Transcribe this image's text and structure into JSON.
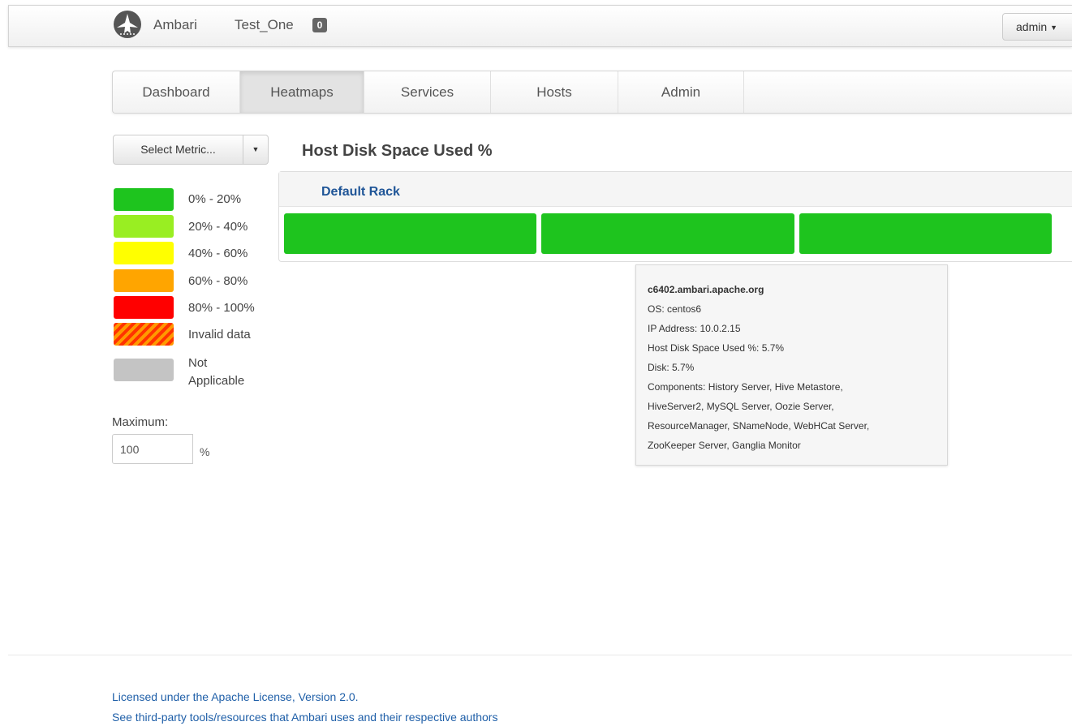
{
  "header": {
    "brand": "Ambari",
    "cluster_name": "Test_One",
    "ops_count": "0",
    "user": "admin"
  },
  "nav": {
    "tabs": [
      {
        "label": "Dashboard",
        "active": false
      },
      {
        "label": "Heatmaps",
        "active": true
      },
      {
        "label": "Services",
        "active": false
      },
      {
        "label": "Hosts",
        "active": false
      },
      {
        "label": "Admin",
        "active": false
      }
    ]
  },
  "sidebar": {
    "metric_button": "Select Metric...",
    "legend": [
      {
        "label": "0% - 20%",
        "color": "#1ec41e"
      },
      {
        "label": "20% - 40%",
        "color": "#99ee22"
      },
      {
        "label": "40% - 60%",
        "color": "#ffff00"
      },
      {
        "label": "60% - 80%",
        "color": "#ffa500"
      },
      {
        "label": "80% - 100%",
        "color": "#ff0000"
      },
      {
        "label": "Invalid data",
        "color": "#ff4400"
      },
      {
        "label_line1": "Not",
        "label_line2": "Applicable",
        "color": "#c4c4c4"
      }
    ],
    "maximum_label": "Maximum:",
    "maximum_value": "100",
    "maximum_unit": "%"
  },
  "heatmap": {
    "title": "Host Disk Space Used %",
    "rack_name": "Default Rack",
    "host_color": "#1ec41e"
  },
  "tooltip": {
    "host": "c6402.ambari.apache.org",
    "os": "OS: centos6",
    "ip": "IP Address: 10.0.2.15",
    "metric": "Host Disk Space Used %: 5.7%",
    "disk": "Disk: 5.7%",
    "components_1": "Components: History Server, Hive Metastore,",
    "components_2": "HiveServer2, MySQL Server, Oozie Server,",
    "components_3": "ResourceManager, SNameNode, WebHCat Server,",
    "components_4": "ZooKeeper Server, Ganglia Monitor"
  },
  "footer": {
    "license": "Licensed under the Apache License, Version 2.0.",
    "third_party": "See third-party tools/resources that Ambari uses and their respective authors"
  }
}
